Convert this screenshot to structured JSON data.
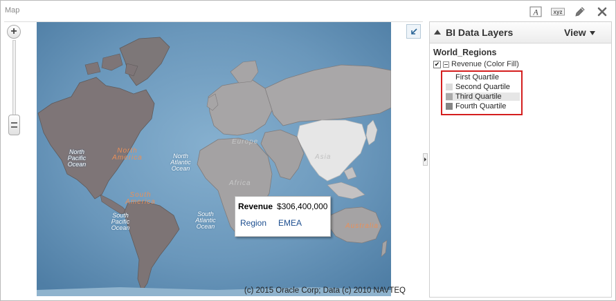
{
  "window": {
    "title": "Map"
  },
  "toolbar": {
    "buttons": [
      {
        "name": "format-text-icon",
        "label": "A"
      },
      {
        "name": "labels-icon",
        "label": "xyz"
      },
      {
        "name": "edit-icon"
      },
      {
        "name": "close-icon"
      }
    ]
  },
  "map": {
    "copyright": "(c) 2015 Oracle Corp; Data (c) 2010 NAVTEQ",
    "labels": {
      "north_america": "North America",
      "south_america": "South America",
      "europe": "Europe",
      "africa": "Africa",
      "asia": "Asia",
      "australia": "Australia",
      "north_pacific": "North Pacific Ocean",
      "south_pacific": "South Pacific Ocean",
      "north_atlantic": "North Atlantic Ocean",
      "south_atlantic": "South Atlantic Ocean"
    },
    "tooltip": {
      "measure_label": "Revenue",
      "measure_value": "$306,400,000",
      "dimension_label": "Region",
      "dimension_value": "EMEA"
    },
    "colors": {
      "ocean": "#5f8fb4",
      "first_quartile": "#f1f1f1",
      "second_quartile": "#d6d6d6",
      "third_quartile": "#aaaaaa",
      "fourth_quartile": "#8a8a8a"
    }
  },
  "panel": {
    "title": "BI Data Layers",
    "view_label": "View",
    "layer_name": "World_Regions",
    "layer_measure": "Revenue (Color Fill)",
    "layer_checked": true,
    "legend": [
      {
        "label": "First Quartile",
        "color": "#ffffff"
      },
      {
        "label": "Second Quartile",
        "color": "#dcdcdc"
      },
      {
        "label": "Third Quartile",
        "color": "#aaaaaa"
      },
      {
        "label": "Fourth Quartile",
        "color": "#858585"
      }
    ]
  }
}
